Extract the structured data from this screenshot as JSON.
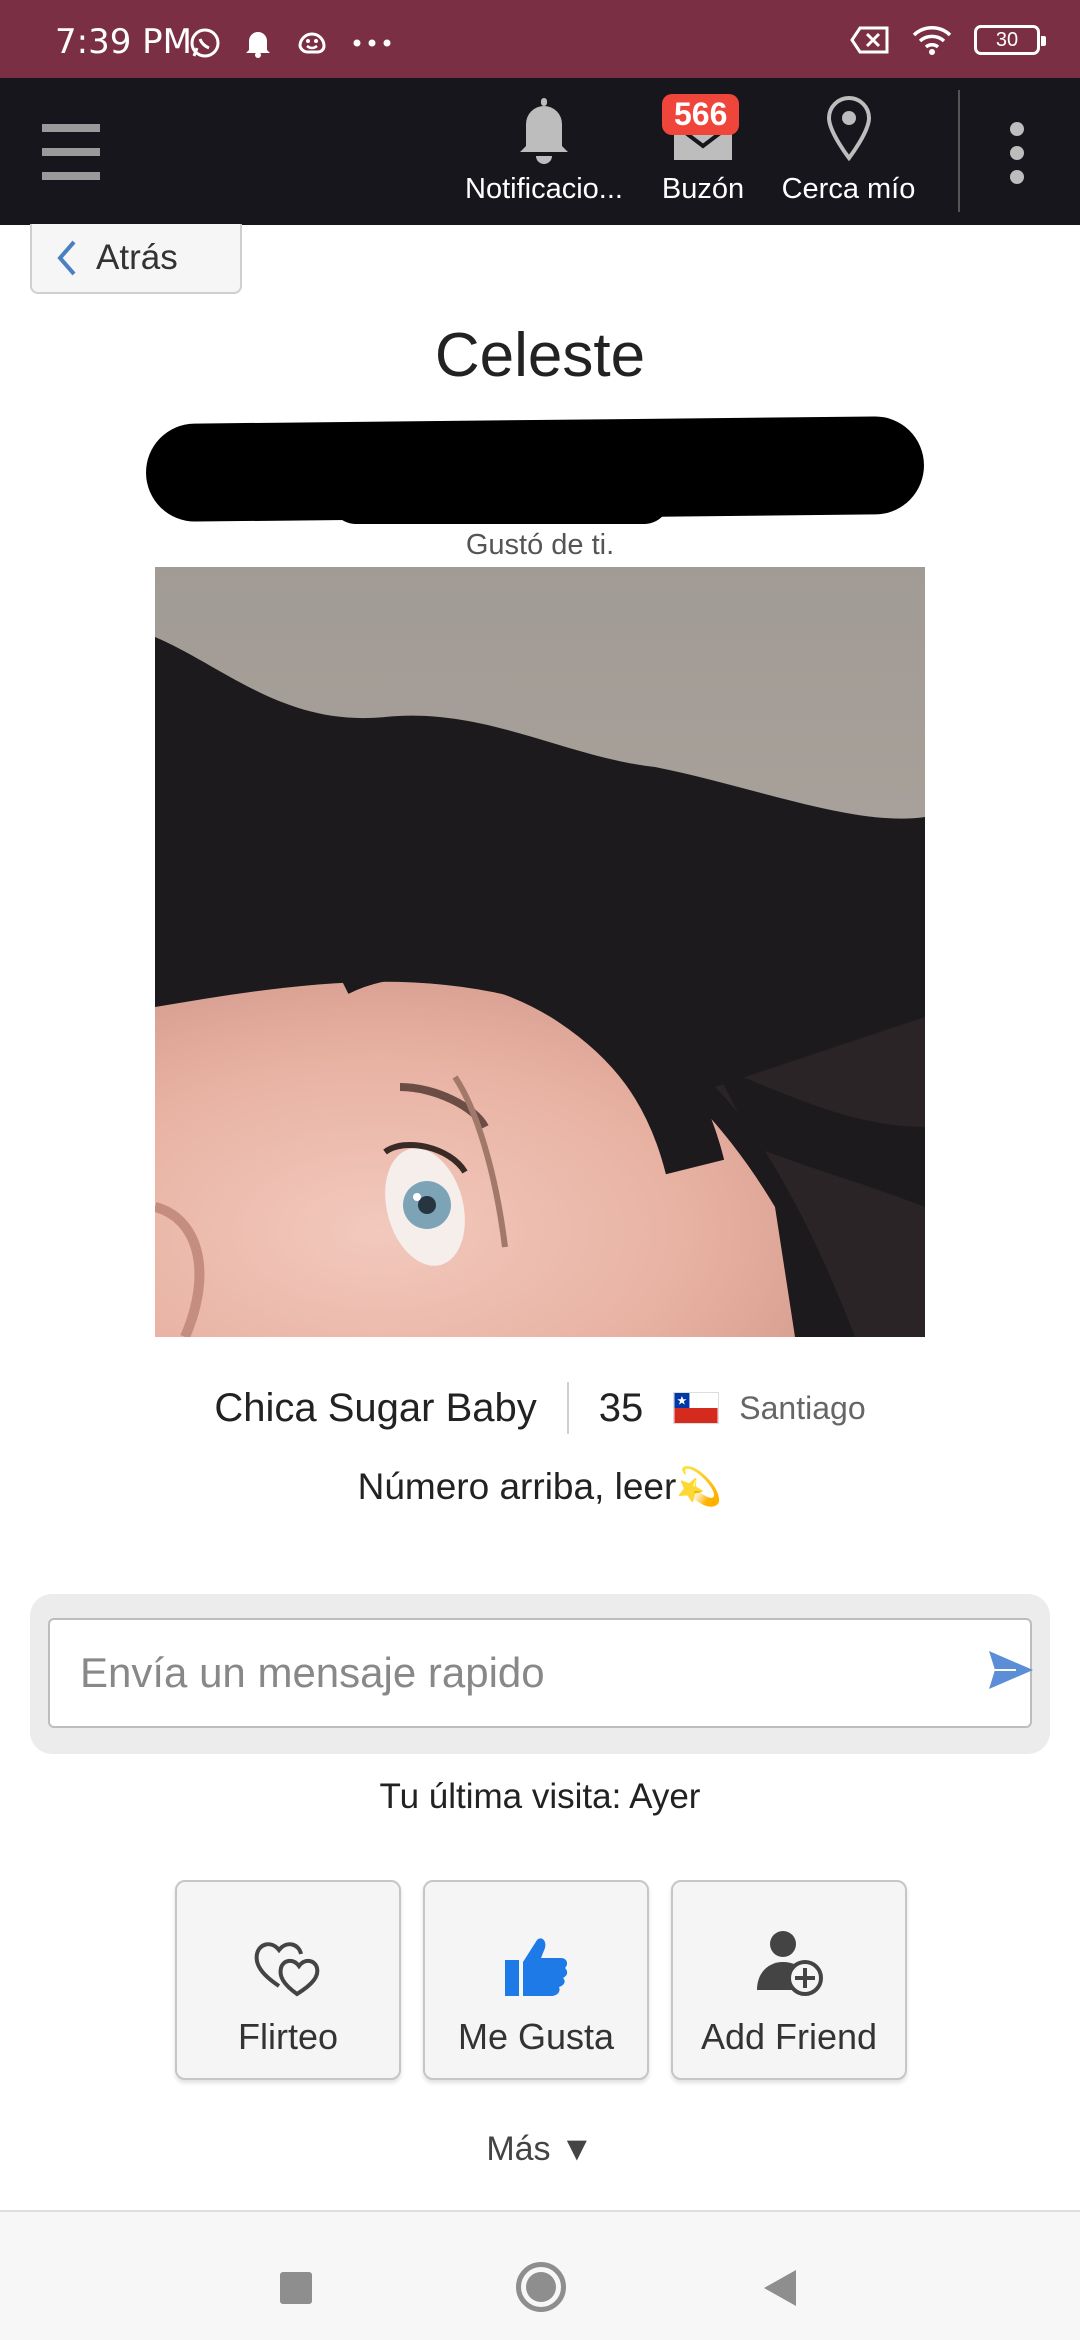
{
  "status_bar": {
    "time": "7:39 PM",
    "battery": "30",
    "icons": [
      "whatsapp-icon",
      "bell-icon",
      "waze-icon",
      "more-dots-icon",
      "no-sim-icon",
      "wifi-icon",
      "battery-icon"
    ]
  },
  "top_nav": {
    "notifications_label": "Notificacio...",
    "inbox_label": "Buzón",
    "inbox_badge": "566",
    "nearby_label": "Cerca mío"
  },
  "back_label": "Atrás",
  "profile": {
    "name": "Celeste",
    "liked_you": "Gustó de ti.",
    "type": "Chica Sugar Baby",
    "age": "35",
    "city": "Santiago",
    "status_message": "Número arriba, leer💫"
  },
  "message": {
    "placeholder": "Envía un mensaje rapido"
  },
  "last_visit": "Tu última visita: Ayer",
  "actions": {
    "flirt": "Flirteo",
    "like": "Me Gusta",
    "add_friend": "Add Friend"
  },
  "more_label": "Más ▼",
  "colors": {
    "status_bar": "#7a2f44",
    "top_bar": "#16161c",
    "badge": "#f0453a",
    "like_blue": "#1e7ae6",
    "send_blue": "#5b8ed6"
  }
}
